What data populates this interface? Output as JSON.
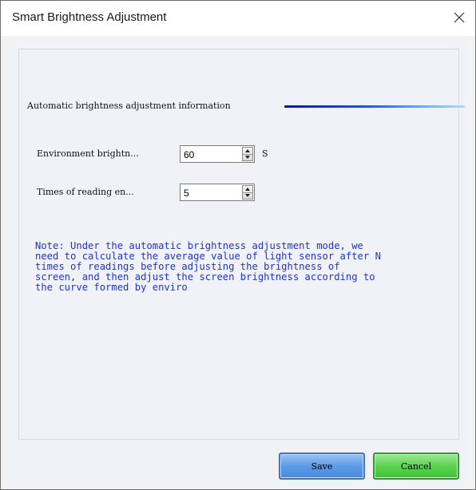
{
  "window": {
    "title": "Smart Brightness Adjustment",
    "close_icon": "close-icon"
  },
  "group": {
    "title": "Automatic brightness adjustment information",
    "line_color": "#2a54c8"
  },
  "fields": {
    "env_label": "Environment brightn...",
    "env_value": "60",
    "env_unit": "S",
    "times_label": "Times of reading en...",
    "times_value": "5"
  },
  "note": {
    "text": "Note: Under the automatic brightness adjustment mode, we\nneed to calculate the average value of light sensor after N\ntimes of readings before adjusting the brightness of\nscreen, and then adjust the screen brightness according to\nthe curve formed by enviro",
    "color": "#1b34d6"
  },
  "buttons": {
    "save": "Save",
    "cancel": "Cancel"
  }
}
